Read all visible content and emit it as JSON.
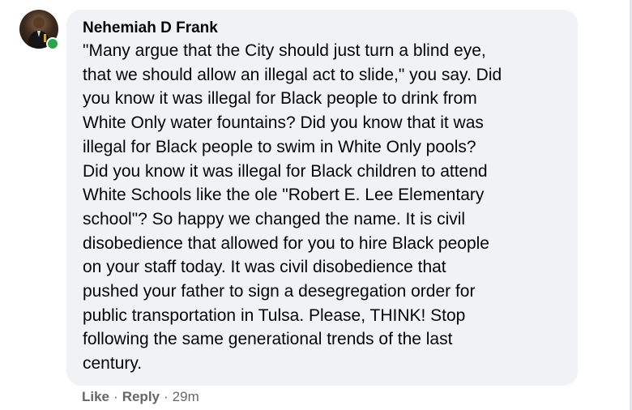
{
  "comment": {
    "author": "Nehemiah D Frank",
    "text": "\"Many argue that the City should just turn a blind eye,\nthat we should allow an illegal act to slide,\" you say. Did\nyou know it was illegal for Black people to drink from\nWhite Only water fountains? Did you know that it was\nillegal for Black people to swim in White Only pools?\nDid you know it was illegal for Black children to attend\nWhite Schools like the ole \"Robert E. Lee Elementary\nschool\"? So happy we changed the name. It is civil\ndisobedience that allowed for you to hire Black people\non your staff today. It was civil disobedience that\npushed your father to sign a desegregation order for\npublic transportation in Tulsa. Please, THINK! Stop\nfollowing the same generational trends of the last\ncentury.",
    "online_status_color": "#31a24c",
    "bubble_color": "#f0f2f5"
  },
  "actions": {
    "like_label": "Like",
    "separator": "·",
    "reply_label": "Reply",
    "timestamp": "29m"
  }
}
